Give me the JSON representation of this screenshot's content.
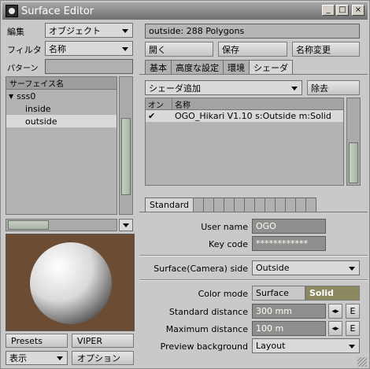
{
  "window": {
    "title": "Surface Editor",
    "min": "_",
    "max": "□",
    "close": "×"
  },
  "left": {
    "edit_label": "編集",
    "edit_value": "オブジェクト",
    "filter_label": "フィルタ",
    "filter_value": "名称",
    "pattern_label": "パターン",
    "pattern_value": "",
    "tree_header": "サーフェイス名",
    "tree": [
      {
        "label": "sss0",
        "expanded": true,
        "selected": false
      },
      {
        "label": "inside",
        "selected": false
      },
      {
        "label": "outside",
        "selected": true
      }
    ],
    "presets": "Presets",
    "viper": "VIPER",
    "display": "表示",
    "options": "オプション"
  },
  "right": {
    "info": "outside: 288 Polygons",
    "open": "開く",
    "save": "保存",
    "rename": "名称変更",
    "tabs": [
      "基本",
      "高度な設定",
      "環境",
      "シェーダ"
    ],
    "active_tab": "シェーダ",
    "add_shader": "シェーダ追加",
    "remove": "除去",
    "shader_cols": [
      "オン",
      "名称"
    ],
    "shaders": [
      {
        "on": "✔",
        "name": "OGO_Hikari V1.10 s:Outside m:Solid"
      }
    ],
    "sub_tab": "Standard",
    "user_name_label": "User name",
    "user_name": "OGO",
    "key_code_label": "Key code",
    "key_code": "************",
    "surface_side_label": "Surface(Camera) side",
    "surface_side": "Outside",
    "color_mode_label": "Color mode",
    "color_mode_options": [
      "Surface",
      "Solid"
    ],
    "color_mode": "Solid",
    "std_dist_label": "Standard distance",
    "std_dist": "300 mm",
    "max_dist_label": "Maximum distance",
    "max_dist": "100 m",
    "preview_bg_label": "Preview background",
    "preview_bg": "Layout",
    "env_button": "E"
  },
  "colors": {
    "title_bar": "#8a8a8a",
    "panel": "#c9c9c9",
    "preview_bg": "#6c4c33",
    "solid_active": "#8c8860"
  }
}
